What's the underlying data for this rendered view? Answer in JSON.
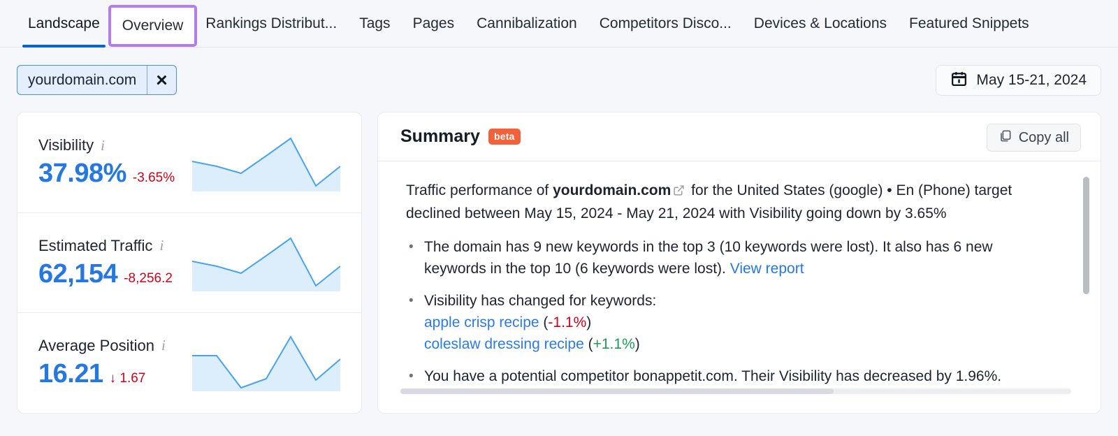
{
  "tabs": [
    {
      "label": "Landscape",
      "state": "active"
    },
    {
      "label": "Overview",
      "state": "highlighted"
    },
    {
      "label": "Rankings Distribut...",
      "state": "default"
    },
    {
      "label": "Tags",
      "state": "default"
    },
    {
      "label": "Pages",
      "state": "default"
    },
    {
      "label": "Cannibalization",
      "state": "default"
    },
    {
      "label": "Competitors Disco...",
      "state": "default"
    },
    {
      "label": "Devices & Locations",
      "state": "default"
    },
    {
      "label": "Featured Snippets",
      "state": "default"
    }
  ],
  "filters": {
    "domain_chip": {
      "label": "yourdomain.com",
      "close_icon": "close-icon"
    },
    "date_picker": {
      "icon": "calendar-icon",
      "value": "May 15-21, 2024"
    }
  },
  "metrics": [
    {
      "title": "Visibility",
      "info_icon": "info-icon",
      "value": "37.98%",
      "delta": "-3.65%",
      "delta_direction": "down",
      "delta_color": "#d0021b"
    },
    {
      "title": "Estimated Traffic",
      "info_icon": "info-icon",
      "value": "62,154",
      "delta": "-8,256.2",
      "delta_direction": "down",
      "delta_color": "#d0021b"
    },
    {
      "title": "Average Position",
      "info_icon": "info-icon",
      "value": "16.21",
      "delta": "↓ 1.67",
      "delta_direction": "down",
      "delta_color": "#d0021b"
    }
  ],
  "summary": {
    "title": "Summary",
    "badge": "beta",
    "copy_button": {
      "label": "Copy all",
      "icon": "copy-icon"
    },
    "intro": {
      "before_domain": "Traffic performance of ",
      "domain": "yourdomain.com",
      "external_icon": "external-link-icon",
      "after_domain": " for the United States (google) • En (Phone) target declined between May 15, 2024 - May 21, 2024 with Visibility going down by 3.65%"
    },
    "bullets": [
      {
        "type": "text_with_link",
        "text": "The domain has 9 new keywords in the top 3 (10 keywords were lost). It also has 6 new keywords in the top 10 (6 keywords were lost). ",
        "link": "View report"
      },
      {
        "type": "keyword_list",
        "text": "Visibility has changed for keywords:",
        "keywords": [
          {
            "name": "apple crisp recipe",
            "change": "-1.1%",
            "direction": "down"
          },
          {
            "name": "coleslaw dressing recipe",
            "change": "+1.1%",
            "direction": "up"
          }
        ]
      },
      {
        "type": "text",
        "text": "You have a potential competitor bonappetit.com. Their Visibility has decreased by 1.96%."
      }
    ]
  },
  "chart_data": [
    {
      "type": "area",
      "title": "Visibility sparkline",
      "x": [
        0,
        1,
        2,
        3,
        4,
        5,
        6
      ],
      "values": [
        52,
        44,
        32,
        60,
        92,
        8,
        35
      ],
      "ylim": [
        0,
        100
      ],
      "line_color": "#4aa3f0",
      "fill_color": "#dceefc"
    },
    {
      "type": "area",
      "title": "Estimated Traffic sparkline",
      "x": [
        0,
        1,
        2,
        3,
        4,
        5,
        6
      ],
      "values": [
        52,
        44,
        32,
        60,
        92,
        8,
        35
      ],
      "ylim": [
        0,
        100
      ],
      "line_color": "#4aa3f0",
      "fill_color": "#dceefc"
    },
    {
      "type": "area",
      "title": "Average Position sparkline",
      "x": [
        0,
        1,
        2,
        3,
        4,
        5,
        6
      ],
      "values": [
        62,
        62,
        6,
        22,
        95,
        18,
        55
      ],
      "ylim": [
        0,
        100
      ],
      "line_color": "#4aa3f0",
      "fill_color": "#dceefc"
    }
  ],
  "scrollbars": {
    "vertical": "summary-vertical-scrollbar",
    "horizontal": "summary-horizontal-scrollbar"
  }
}
